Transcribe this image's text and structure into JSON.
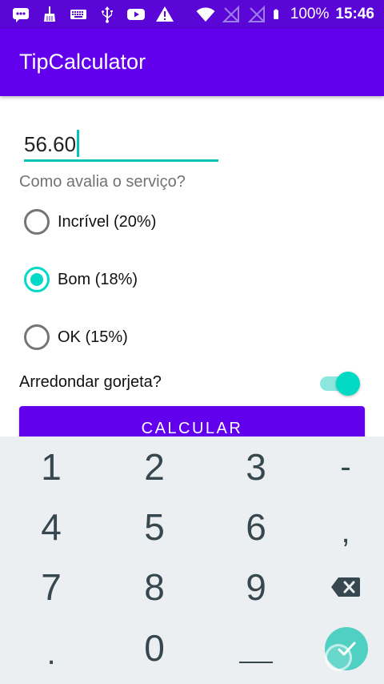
{
  "status_bar": {
    "battery_percent": "100%",
    "time": "15:46",
    "icons": [
      "chat-icon",
      "broom-icon",
      "keyboard-icon",
      "usb-icon",
      "youtube-icon",
      "warning-icon",
      "wifi-icon",
      "no-sim-icon",
      "no-sim-icon",
      "battery-icon"
    ]
  },
  "app": {
    "title": "TipCalculator"
  },
  "form": {
    "amount_value": "56.60",
    "question": "Como avalia o serviço?",
    "options": [
      {
        "label": "Incrível (20%)",
        "checked": false
      },
      {
        "label": "Bom (18%)",
        "checked": true
      },
      {
        "label": "OK (15%)",
        "checked": false
      }
    ],
    "round_label": "Arredondar gorjeta?",
    "round_enabled": true,
    "calculate_label": "CALCULAR"
  },
  "keyboard": {
    "rows": [
      [
        "1",
        "2",
        "3",
        "-"
      ],
      [
        "4",
        "5",
        "6",
        ","
      ],
      [
        "7",
        "8",
        "9",
        "backspace-icon"
      ],
      [
        ".",
        "0",
        "space",
        "done-icon"
      ]
    ]
  },
  "colors": {
    "primary": "#6200ee",
    "primary_dark": "#5a06d6",
    "accent": "#03dac5",
    "keyboard_bg": "#eceff1",
    "key_text": "#37474f"
  }
}
